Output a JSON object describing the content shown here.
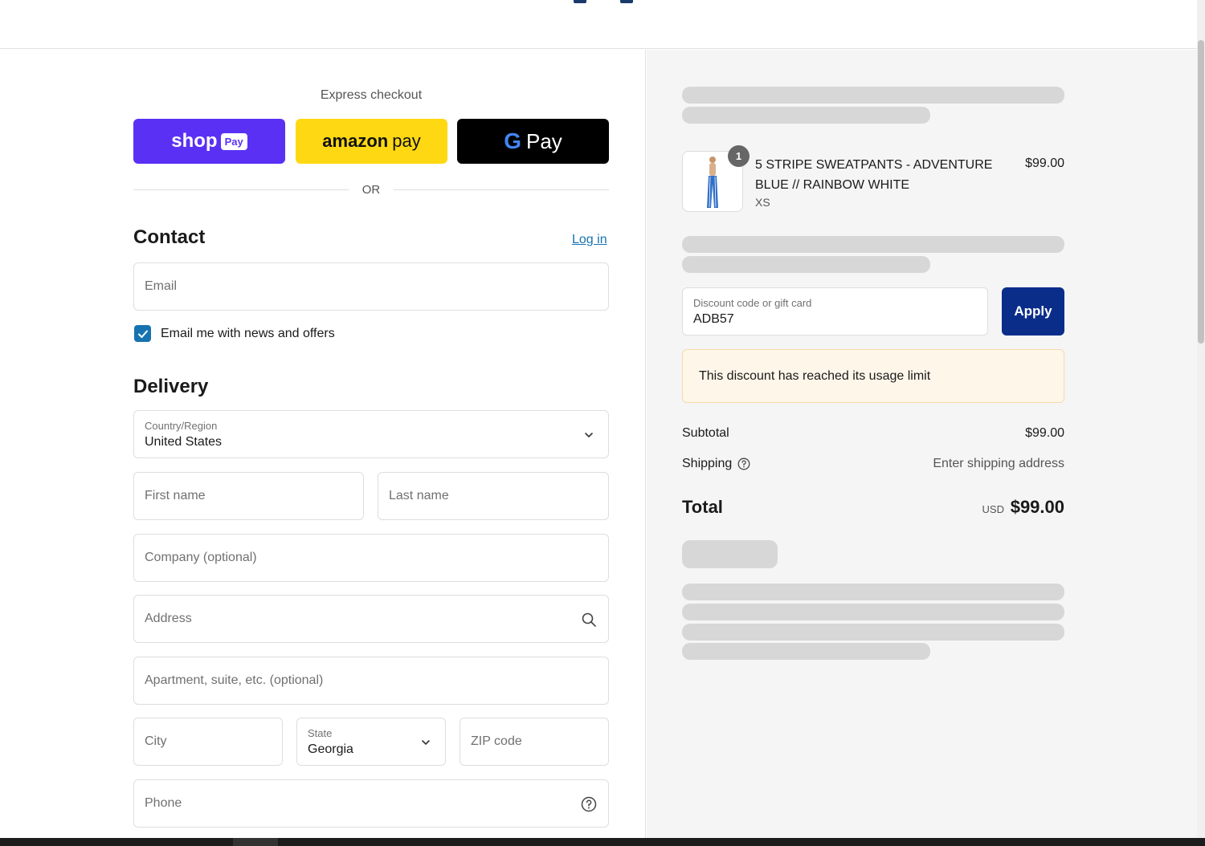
{
  "express": {
    "title": "Express checkout",
    "shop_label": "shop",
    "shop_badge": "Pay",
    "amazon_label_a": "amazon",
    "amazon_label_b": "pay",
    "gpay_g": "G",
    "gpay_label": "Pay",
    "or_label": "OR"
  },
  "contact": {
    "heading": "Contact",
    "login_label": "Log in",
    "email_placeholder": "Email",
    "newsletter_label": "Email me with news and offers",
    "newsletter_checked": true
  },
  "delivery": {
    "heading": "Delivery",
    "country_label": "Country/Region",
    "country_value": "United States",
    "first_name_placeholder": "First name",
    "last_name_placeholder": "Last name",
    "company_placeholder": "Company (optional)",
    "address_placeholder": "Address",
    "apartment_placeholder": "Apartment, suite, etc. (optional)",
    "city_placeholder": "City",
    "state_label": "State",
    "state_value": "Georgia",
    "zip_placeholder": "ZIP code",
    "phone_placeholder": "Phone"
  },
  "order": {
    "quantity": "1",
    "product_name": "5 STRIPE SWEATPANTS - ADVENTURE BLUE // RAINBOW WHITE",
    "product_variant": "XS",
    "product_price": "$99.00",
    "discount_label": "Discount code or gift card",
    "discount_value": "ADB57",
    "apply_label": "Apply",
    "discount_error": "This discount has reached its usage limit",
    "subtotal_label": "Subtotal",
    "subtotal_value": "$99.00",
    "shipping_label": "Shipping",
    "shipping_value": "Enter shipping address",
    "total_label": "Total",
    "total_currency": "USD",
    "total_value": "$99.00"
  },
  "colors": {
    "shop_pay": "#5a31f4",
    "amazon_pay": "#ffd814",
    "google_pay": "#000000",
    "link": "#1773b0",
    "apply_button": "#0a2d8a",
    "warning_bg": "#fff6ea"
  }
}
